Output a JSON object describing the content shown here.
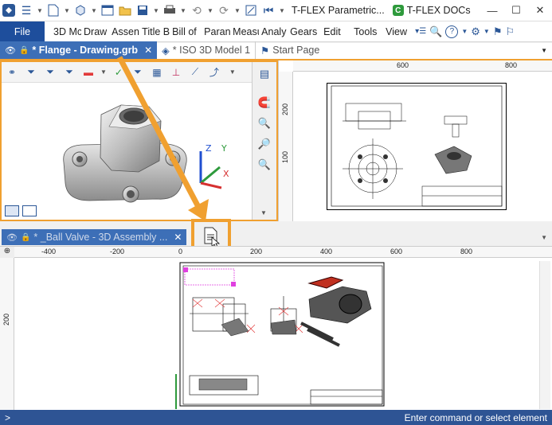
{
  "titlebar": {
    "app_title": "T-FLEX Parametric...",
    "docs_label": "T-FLEX DOCs",
    "docs_icon_letter": "C"
  },
  "menu": {
    "file": "File",
    "items": [
      "3D Mc",
      "Draw",
      "Assen",
      "Title B",
      "Bill of",
      "Paran",
      "Measu",
      "Analy",
      "Gears",
      "Edit",
      "Tools",
      "View"
    ]
  },
  "tabs": {
    "active": "* Flange - Drawing.grb",
    "second": "* ISO 3D Model 1",
    "third": "Start Page"
  },
  "mid_tab": "* _Ball Valve - 3D Assembly ...",
  "status": {
    "prompt": ">",
    "message": "Enter command or select element"
  },
  "ruler_top_lower": [
    "-400",
    "-200",
    "0",
    "200",
    "400",
    "600",
    "800"
  ],
  "ruler_left_lower": [
    "200"
  ],
  "ruler_top_right": [
    "600",
    "800"
  ],
  "ruler_left_right": [
    "200",
    "100"
  ],
  "axes": {
    "z": "Z",
    "y": "Y",
    "x": "X"
  },
  "colors": {
    "accent": "#f0a030",
    "brand": "#2e5494",
    "tab_active": "#3d6fb7"
  }
}
